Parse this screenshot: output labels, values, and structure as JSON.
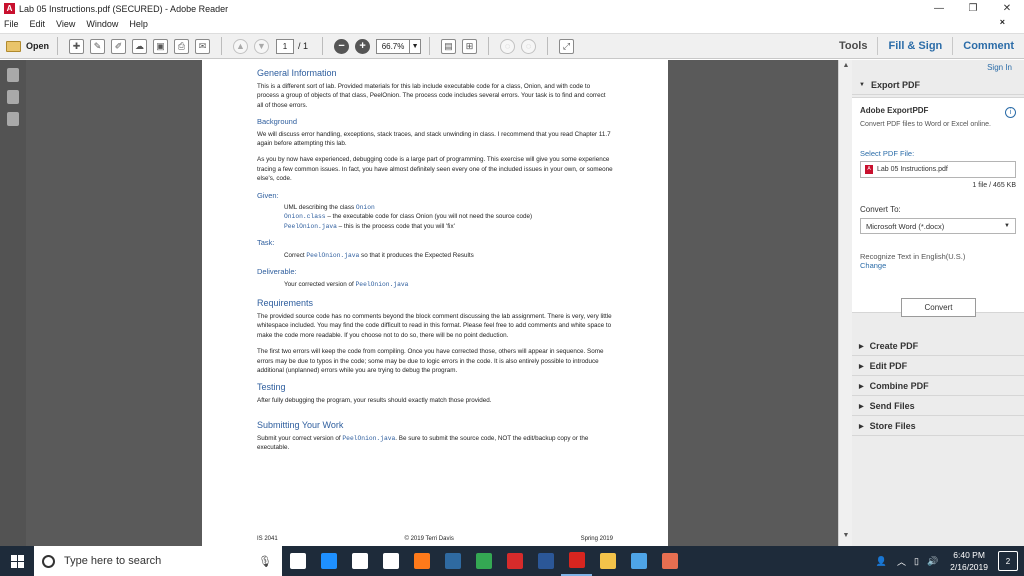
{
  "window": {
    "title": "Lab 05 Instructions.pdf (SECURED) - Adobe Reader",
    "app_icon": "adobe-reader-icon",
    "close_doc": "×"
  },
  "menu": [
    "File",
    "Edit",
    "View",
    "Window",
    "Help"
  ],
  "toolbar": {
    "open_label": "Open",
    "page_current": "1",
    "page_total": "/ 1",
    "zoom_value": "66.7%",
    "tools_label": "Tools",
    "fill_sign_label": "Fill & Sign",
    "comment_label": "Comment"
  },
  "document": {
    "general_info": {
      "heading": "General Information",
      "p1": "This is a different sort of lab. Provided materials for this lab include executable code for a class, Onion, and with code to process a group of objects of that class, PeelOnion. The process code includes several errors. Your task is to find and correct all of those errors."
    },
    "background": {
      "sub": "Background",
      "p1": "We will discuss error handling, exceptions, stack traces, and stack unwinding in class. I recommend that you read Chapter 11.7 again before attempting this lab.",
      "p2": "As you by now have experienced, debugging code is a large part of programming. This exercise will give you some experience tracing a few common issues. In fact, you have almost definitely seen every one of the included issues in your own, or someone else's, code."
    },
    "given": {
      "sub": "Given:",
      "l1_text": "UML describing the class ",
      "l1_code": "Onion",
      "l2_code": "Onion.class",
      "l2_text": " – the executable code for class Onion (you will not need the source code)",
      "l3_code": "PeelOnion.java",
      "l3_text": " – this is the process code that you will 'fix'"
    },
    "task": {
      "sub": "Task:",
      "t1": "Correct ",
      "code": "PeelOnion.java",
      "t2": " so that it produces the Expected Results"
    },
    "deliverable": {
      "sub": "Deliverable:",
      "t1": "Your corrected version of ",
      "code": "PeelOnion.java"
    },
    "requirements": {
      "heading": "Requirements",
      "p1": "The provided source code has no comments beyond the block comment discussing the lab assignment. There is very, very little whitespace included. You may find the code difficult to read in this format. Please feel free to add comments and white space to make the code more readable. If you choose not to do so, there will be no point deduction.",
      "p2": "The first two errors will keep the code from compiling. Once you have corrected those, others will appear in sequence. Some errors may be due to typos in the code; some may be due to logic errors in the code. It is also entirely possible to introduce additional (unplanned) errors while you are trying to debug the program."
    },
    "testing": {
      "heading": "Testing",
      "p1": "After fully debugging the program, your results should exactly match those provided."
    },
    "submitting": {
      "heading": "Submitting Your Work",
      "t1": "Submit your correct version of ",
      "code": "PeelOnion.java",
      "t2": ". Be sure to submit the source code, NOT the edit/backup copy or the executable."
    },
    "footer": {
      "left": "IS 2041",
      "center": "© 2019 Terri Davis",
      "right": "Spring 2019"
    }
  },
  "right_panel": {
    "sign_in": "Sign In",
    "export_pdf_header": "Export PDF",
    "export_title": "Adobe ExportPDF",
    "export_desc": "Convert PDF files to Word or Excel online.",
    "select_label": "Select PDF File:",
    "file_name": "Lab 05 Instructions.pdf",
    "file_info": "1 file / 465 KB",
    "convert_to_label": "Convert To:",
    "convert_to_value": "Microsoft Word (*.docx)",
    "recognize_text": "Recognize Text in English(U.S.)",
    "change_label": "Change",
    "convert_button": "Convert",
    "sections": [
      "Create PDF",
      "Edit PDF",
      "Combine PDF",
      "Send Files",
      "Store Files"
    ]
  },
  "taskbar": {
    "search_placeholder": "Type here to search",
    "time": "6:40 PM",
    "date": "2/16/2019",
    "notifications": "2",
    "apps": [
      {
        "name": "task-view-icon",
        "color": "#ffffff"
      },
      {
        "name": "edge-icon",
        "color": "#1e90ff"
      },
      {
        "name": "store-icon",
        "color": "#ffffff"
      },
      {
        "name": "amazon-icon",
        "color": "#ffffff"
      },
      {
        "name": "firefox-icon",
        "color": "#ff7a1a"
      },
      {
        "name": "python-icon",
        "color": "#2f6aa1"
      },
      {
        "name": "chrome-icon",
        "color": "#34a853"
      },
      {
        "name": "shield-app-icon",
        "color": "#d62b2b"
      },
      {
        "name": "word-icon",
        "color": "#2b5797"
      },
      {
        "name": "acrobat-icon",
        "color": "#d7251f"
      },
      {
        "name": "explorer-icon",
        "color": "#f3c34a"
      },
      {
        "name": "notes-icon",
        "color": "#4ea5e8"
      },
      {
        "name": "java-icon",
        "color": "#e76f51"
      }
    ]
  }
}
